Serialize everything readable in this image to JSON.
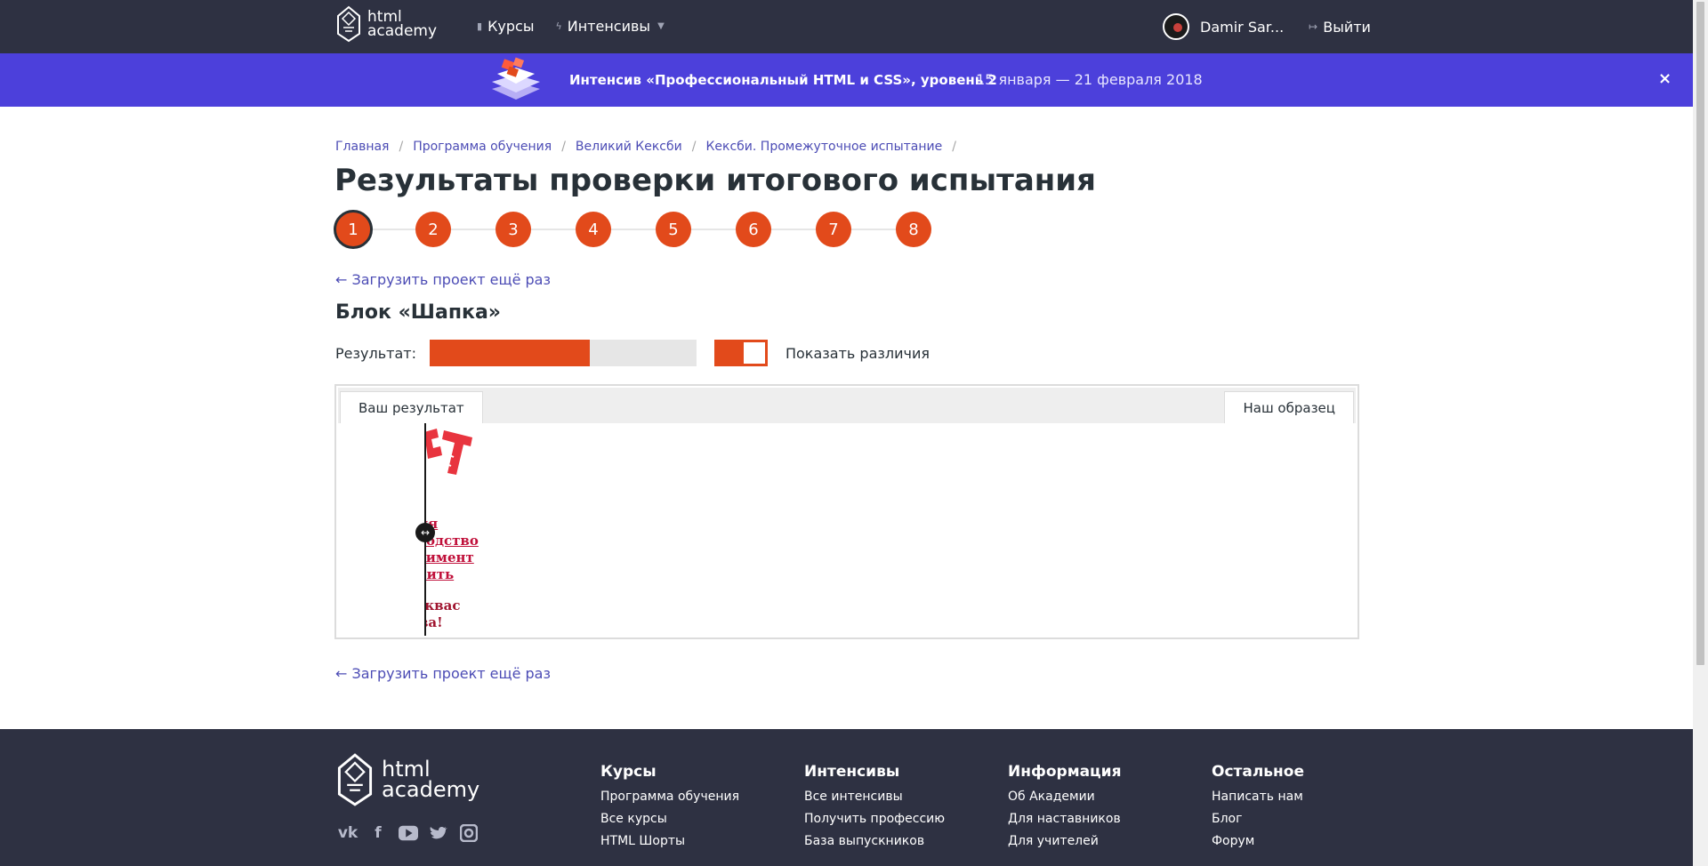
{
  "header": {
    "logo_line1": "html",
    "logo_line2": "academy",
    "nav": [
      {
        "label": "Курсы",
        "icon": "bar-chart-icon"
      },
      {
        "label": "Интенсивы",
        "icon": "lightning-icon"
      }
    ],
    "user_name": "Damir Sar...",
    "logout_label": "Выйти"
  },
  "promo": {
    "title": "Интенсив «Профессиональный HTML и CSS», уровень 2",
    "dates": "15 января — 21 февраля 2018",
    "close": "×"
  },
  "breadcrumbs": [
    "Главная",
    "Программа обучения",
    "Великий Кексби",
    "Кексби. Промежуточное испытание"
  ],
  "page_title": "Результаты проверки итогового испытания",
  "steps": [
    "1",
    "2",
    "3",
    "4",
    "5",
    "6",
    "7",
    "8"
  ],
  "active_step": "1",
  "reload_label": "← Загрузить проект ещё раз",
  "block_title": "Блок «Шапка»",
  "result": {
    "label": "Результат:",
    "fraction": 0.6,
    "show_diff_label": "Показать различия",
    "show_diff_on": true
  },
  "compare": {
    "tab_yours": "Ваш результат",
    "tab_sample": "Наш образец",
    "handle": "↔",
    "nav_fragments": [
      "ния",
      "зводство",
      "ртимент",
      "упить"
    ],
    "promo_fragments": [
      "й квас",
      "ова!"
    ]
  },
  "footer": {
    "logo_line1": "html",
    "logo_line2": "academy",
    "socials": [
      "vk-icon",
      "facebook-icon",
      "youtube-icon",
      "twitter-icon",
      "instagram-icon"
    ],
    "columns": [
      {
        "title": "Курсы",
        "links": [
          "Программа обучения",
          "Все курсы",
          "HTML Шорты"
        ]
      },
      {
        "title": "Интенсивы",
        "links": [
          "Все интенсивы",
          "Получить профессию",
          "База выпускников"
        ]
      },
      {
        "title": "Информация",
        "links": [
          "Об Академии",
          "Для наставников",
          "Для учителей"
        ]
      },
      {
        "title": "Остальное",
        "links": [
          "Написать нам",
          "Блог",
          "Форум"
        ]
      }
    ]
  },
  "colors": {
    "header_bg": "#2e3142",
    "promo_bg": "#4c40db",
    "accent": "#e24a1b",
    "link": "#4c4cb5"
  }
}
